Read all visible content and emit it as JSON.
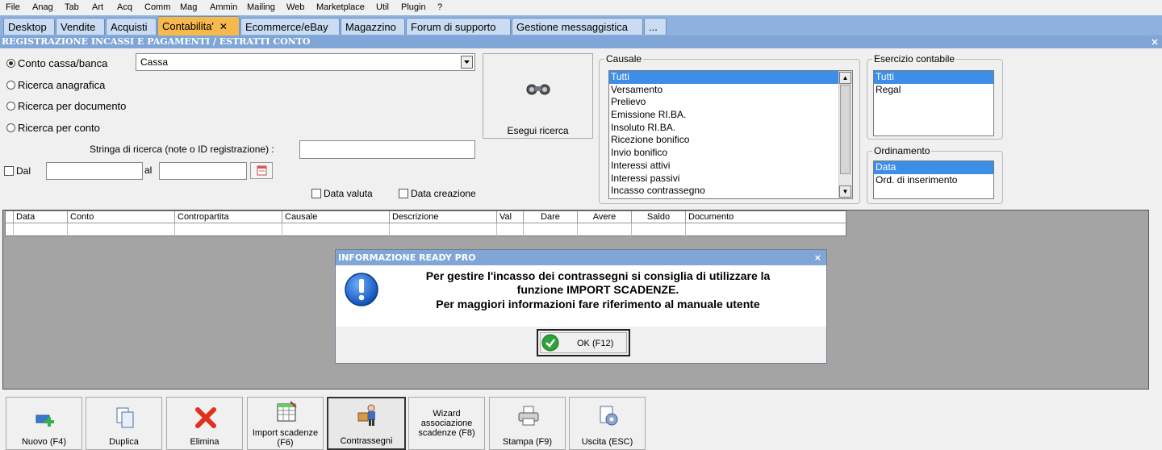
{
  "menu": [
    "File",
    "Anag",
    "Tab",
    "Art",
    "Acq",
    "Comm",
    "Mag",
    "Ammin",
    "Mailing",
    "Web",
    "Marketplace",
    "Util",
    "Plugin",
    "?"
  ],
  "tabs": [
    {
      "label": "Desktop"
    },
    {
      "label": "Vendite"
    },
    {
      "label": "Acquisti"
    },
    {
      "label": "Contabilita'",
      "active": true,
      "close": "✕"
    },
    {
      "label": "Ecommerce/eBay"
    },
    {
      "label": "Magazzino"
    },
    {
      "label": "Forum di supporto"
    },
    {
      "label": "Gestione messaggistica"
    },
    {
      "label": "..."
    }
  ],
  "window": {
    "title": "REGISTRAZIONE INCASSI E PAGAMENTI / ESTRATTI CONTO",
    "close": "×"
  },
  "search": {
    "radios": [
      {
        "label": "Conto cassa/banca",
        "checked": true
      },
      {
        "label": "Ricerca anagrafica"
      },
      {
        "label": "Ricerca per documento"
      },
      {
        "label": "Ricerca per conto"
      }
    ],
    "conto_value": "Cassa",
    "stringa_label": "Stringa di ricerca (note o ID registrazione) :",
    "stringa_value": "",
    "dal_label": "Dal",
    "al_label": "al",
    "data_valuta_label": "Data valuta",
    "data_creazione_label": "Data creazione",
    "esegui_label": "Esegui ricerca"
  },
  "causale": {
    "title": "Causale",
    "items": [
      "Tutti",
      "Versamento",
      "Prelievo",
      "Emissione RI.BA.",
      "Insoluto RI.BA.",
      "Ricezione bonifico",
      "Invio bonifico",
      "Interessi attivi",
      "Interessi passivi",
      "Incasso contrassegno"
    ],
    "selected": 0
  },
  "esercizio": {
    "title": "Esercizio contabile",
    "items": [
      "Tutti",
      "Regal"
    ],
    "selected": 0
  },
  "ordinamento": {
    "title": "Ordinamento",
    "items": [
      "Data",
      "Ord. di inserimento"
    ],
    "selected": 0
  },
  "grid": {
    "columns": [
      "Data",
      "Conto",
      "Contropartita",
      "Causale",
      "Descrizione",
      "Val",
      "Dare",
      "Avere",
      "Saldo",
      "Documento"
    ]
  },
  "dialog": {
    "title": "INFORMAZIONE READY PRO",
    "close": "×",
    "lines": [
      "Per gestire l'incasso dei contrassegni si consiglia di utilizzare la",
      "funzione IMPORT SCADENZE.",
      "Per maggiori informazioni fare riferimento al manuale utente"
    ],
    "ok_label": "OK (F12)"
  },
  "toolbar": {
    "nuovo": "Nuovo (F4)",
    "duplica": "Duplica",
    "elimina": "Elimina",
    "import_1": "Import scadenze",
    "import_2": "(F6)",
    "contrassegni": "Contrassegni",
    "wizard_1": "Wizard",
    "wizard_2": "associazione",
    "wizard_3": "scadenze (F8)",
    "stampa": "Stampa (F9)",
    "uscita": "Uscita (ESC)"
  },
  "colors": {
    "tabbar": "#8eb1dd",
    "active_tab": "#f7b84c",
    "titlebar": "#7fa6d6",
    "selection": "#3d8ee6",
    "grid_bg": "#a4a4a4"
  }
}
